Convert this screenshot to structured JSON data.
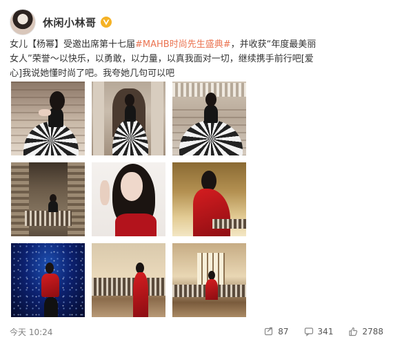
{
  "user": {
    "name": "休闲小林哥"
  },
  "post": {
    "line1_prefix": "女儿【杨幂】受邀出席第十七届",
    "hashtag": "#MAHB时尚先生盛典#",
    "line1_suffix": "，并收获“年度最美丽",
    "line2": "女人”荣誉～以快乐，以勇敢，以力量，以真我面对一切，继续携手前行吧[爱",
    "line3": "心]我说她懂时尚了吧。我夸她几句可以吧"
  },
  "footer": {
    "timestamp": "今天 10:24",
    "reposts": "87",
    "comments": "341",
    "likes": "2788"
  },
  "colors": {
    "hashtag": "#eb7350",
    "verified_badge": "#f5b225",
    "footer_text": "#808080"
  },
  "icons": {
    "verified": "verified-badge-icon",
    "repost": "repost-icon",
    "comment": "comment-icon",
    "like": "like-icon"
  }
}
